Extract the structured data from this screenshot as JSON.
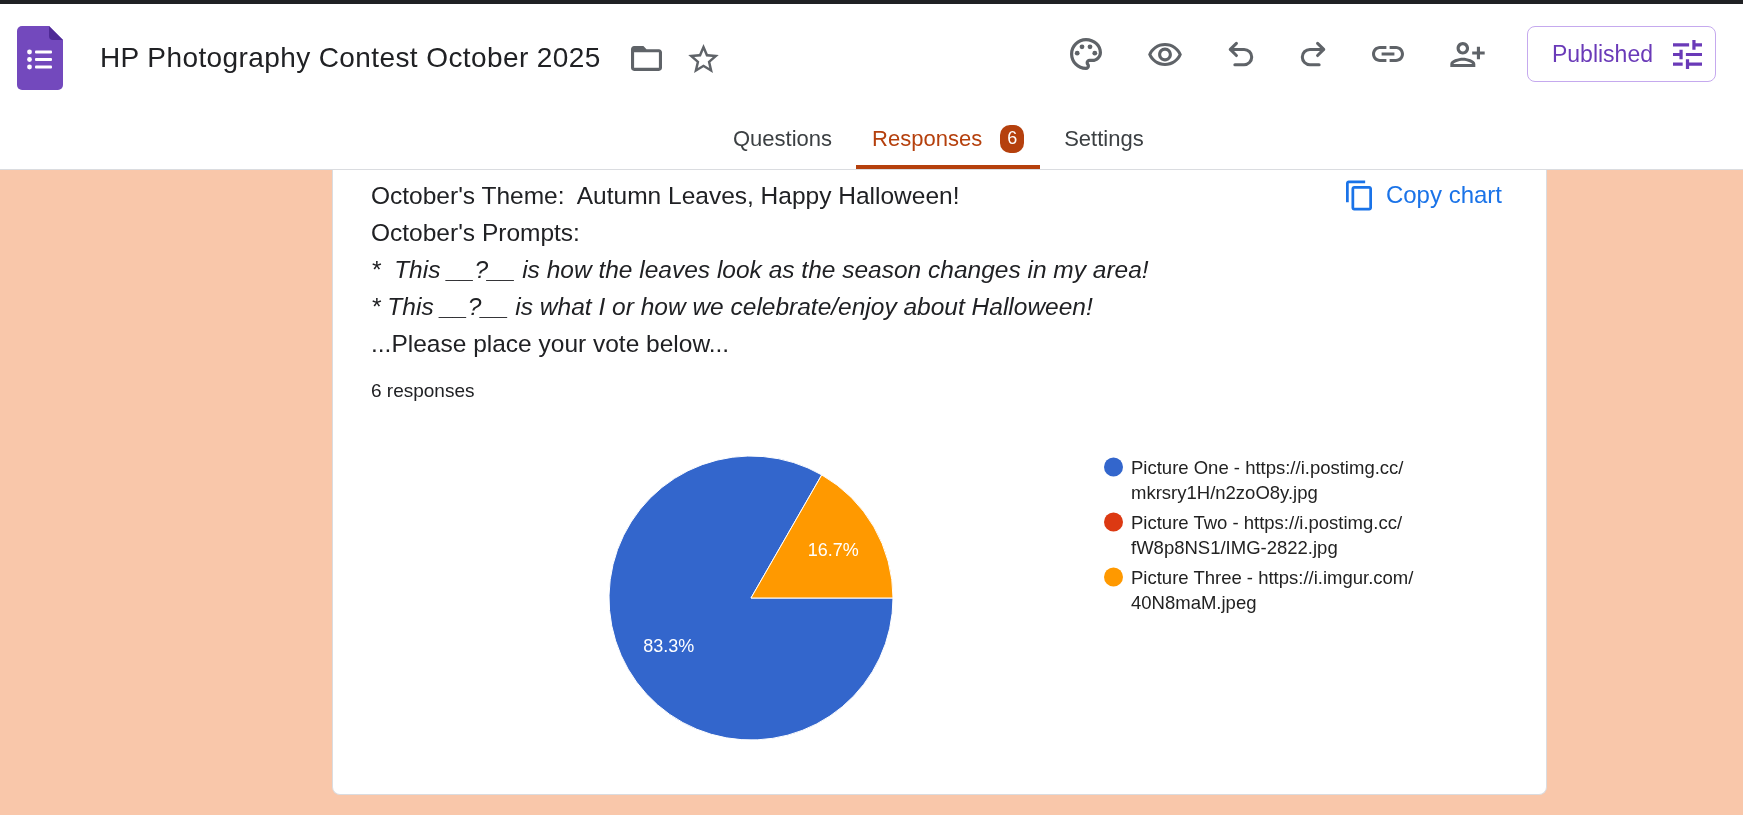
{
  "header": {
    "title": "HP Photography Contest October 2025",
    "starred": false,
    "publish_button": "Published"
  },
  "tabs": [
    {
      "label": "Questions",
      "selected": false
    },
    {
      "label": "Responses",
      "selected": true,
      "badge": "6"
    },
    {
      "label": "Settings",
      "selected": false
    }
  ],
  "question": {
    "description": [
      {
        "text": "October's Theme:  Autumn Leaves, Happy Halloween!",
        "italic": false
      },
      {
        "text": "October's Prompts:",
        "italic": false
      },
      {
        "text": "*  This __?__ is how the leaves look as the season changes in my area!",
        "italic": true
      },
      {
        "text": "* This __?__ is what I or how we celebrate/enjoy about Halloween!",
        "italic": true
      },
      {
        "text": "...Please place your vote below...",
        "italic": false
      }
    ],
    "copy_button": "Copy chart",
    "response_count": "6 responses",
    "chart_data": {
      "type": "pie",
      "categories": [
        "Picture One - https://i.postimg.cc/mkrsry1H/n2zoO8y.jpg",
        "Picture Two - https://i.postimg.cc/fW8p8NS1/IMG-2822.jpg",
        "Picture Three - https://i.imgur.com/40N8maM.jpeg"
      ],
      "values": [
        83.3,
        0,
        16.7
      ],
      "colors": [
        "#3366cc",
        "#dc3912",
        "#ff9900"
      ],
      "value_labels": [
        "83.3%",
        null,
        "16.7%"
      ],
      "legend": "right"
    }
  }
}
